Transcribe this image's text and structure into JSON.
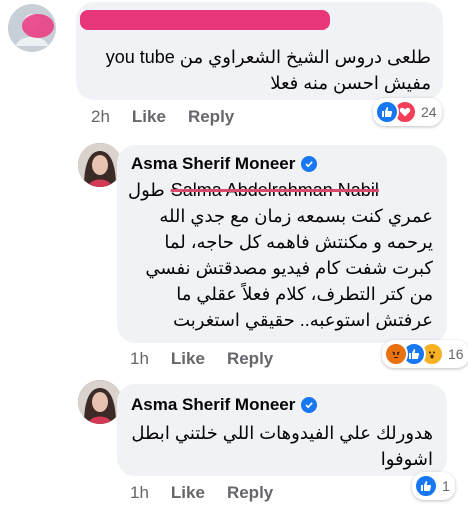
{
  "comments": [
    {
      "author": "",
      "text": [
        "طلعى دروس الشيخ  الشعراوي من you tube",
        "مفيش احسن منه فعلا"
      ],
      "time": "2h",
      "like_label": "Like",
      "reply_label": "Reply",
      "reactions": [
        "like",
        "love"
      ],
      "reaction_count": "24"
    },
    {
      "author": "Asma Sherif Moneer",
      "mention": "Salma Abdelrahman Nabil",
      "text": [
        "طول",
        "عمري كنت بسمعه زمان مع جدي الله",
        "يرحمه و مكنتش فاهمه كل حاجه، لما",
        "كبرت شفت كام فيديو مصدقتش نفسي",
        "من كتر التطرف، كلام فعلاً عقلي ما",
        "عرفتش استوعبه.. حقيقي استغربت"
      ],
      "time": "1h",
      "like_label": "Like",
      "reply_label": "Reply",
      "reactions": [
        "angry",
        "like",
        "wow"
      ],
      "reaction_count": "16"
    },
    {
      "author": "Asma Sherif Moneer",
      "text": [
        "هدورلك علي الفيدوهات اللي خلتني ابطل",
        "اشوفوا"
      ],
      "time": "1h",
      "like_label": "Like",
      "reply_label": "Reply",
      "reactions": [
        "like"
      ],
      "reaction_count": "1"
    }
  ],
  "colors": {
    "like_blue": "#1877f2",
    "love_red": "#f33e58",
    "angry_orange": "#e9710f",
    "wow_yellow": "#f7b125",
    "redaction_pink": "#e8367a"
  }
}
